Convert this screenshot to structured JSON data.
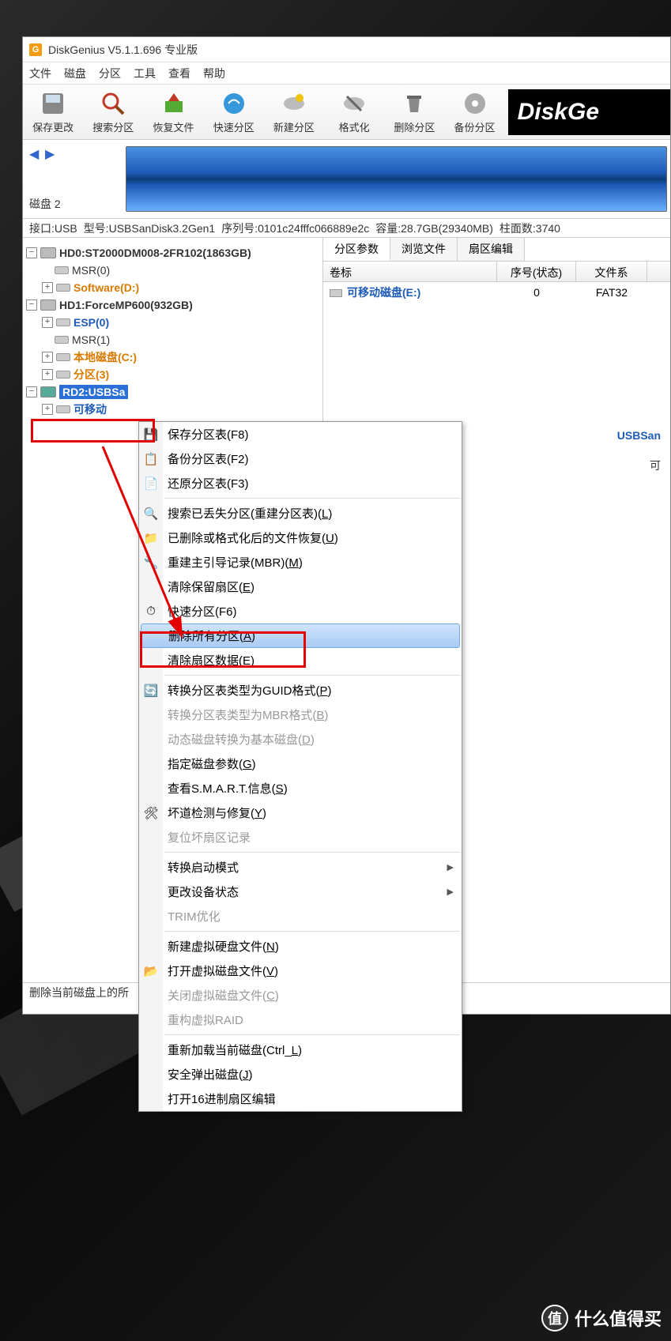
{
  "title": "DiskGenius V5.1.1.696 专业版",
  "menu": [
    "文件",
    "磁盘",
    "分区",
    "工具",
    "查看",
    "帮助"
  ],
  "toolbar": [
    "保存更改",
    "搜索分区",
    "恢复文件",
    "快速分区",
    "新建分区",
    "格式化",
    "删除分区",
    "备份分区"
  ],
  "logo_text": "DiskGe",
  "disk_nav_label": "磁盘 2",
  "info_bar": {
    "iface_k": "接口:",
    "iface_v": "USB",
    "model_k": "型号:",
    "model_v": "USBSanDisk3.2Gen1",
    "serial_k": "序列号:",
    "serial_v": "0101c24fffc066889e2c",
    "cap_k": "容量:",
    "cap_v": "28.7GB(29340MB)",
    "cyl_k": "柱面数:",
    "cyl_v": "3740"
  },
  "tree": {
    "hd0": "HD0:ST2000DM008-2FR102(1863GB)",
    "msr0": "MSR(0)",
    "soft": "Software(D:)",
    "hd1": "HD1:ForceMP600(932GB)",
    "esp": "ESP(0)",
    "msr1": "MSR(1)",
    "local": "本地磁盘(C:)",
    "p3": "分区(3)",
    "rd2": "RD2:USBSa",
    "removable": "可移动"
  },
  "tabs": [
    "分区参数",
    "浏览文件",
    "扇区编辑"
  ],
  "grid_head": {
    "vol": "卷标",
    "idx": "序号(状态)",
    "fs": "文件系"
  },
  "grid_row": {
    "vol": "可移动磁盘(E:)",
    "idx": "0",
    "fs": "FAT32"
  },
  "right_info": "USBSan",
  "right_info2": "可",
  "status": "删除当前磁盘上的所",
  "ctx": {
    "save": "保存分区表(F8)",
    "backup": "备份分区表(F2)",
    "restore": "还原分区表(F3)",
    "search": "搜索已丢失分区(重建分区表)(",
    "search_u": "L",
    "search_e": ")",
    "recover": "已删除或格式化后的文件恢复(",
    "recover_u": "U",
    "recover_e": ")",
    "mbr": "重建主引导记录(MBR)(",
    "mbr_u": "M",
    "mbr_e": ")",
    "clear_reserved": "清除保留扇区(",
    "clear_reserved_u": "E",
    "clear_reserved_e": ")",
    "quick": "快速分区(F6)",
    "delete_all": "删除所有分区(",
    "delete_all_u": "A",
    "delete_all_e": ")",
    "clear_sector": "清除扇区数据(",
    "clear_sector_u": "E",
    "clear_sector_e": ")",
    "to_guid": "转换分区表类型为GUID格式(",
    "to_guid_u": "P",
    "to_guid_e": ")",
    "to_mbr": "转换分区表类型为MBR格式(",
    "to_mbr_u": "B",
    "to_mbr_e": ")",
    "to_basic": "动态磁盘转换为基本磁盘(",
    "to_basic_u": "D",
    "to_basic_e": ")",
    "params": "指定磁盘参数(",
    "params_u": "G",
    "params_e": ")",
    "smart": "查看S.M.A.R.T.信息(",
    "smart_u": "S",
    "smart_e": ")",
    "bad": "坏道检测与修复(",
    "bad_u": "Y",
    "bad_e": ")",
    "reset_bad": "复位坏扇区记录",
    "boot": "转换启动模式",
    "device_state": "更改设备状态",
    "trim": "TRIM优化",
    "new_vhd": "新建虚拟硬盘文件(",
    "new_vhd_u": "N",
    "new_vhd_e": ")",
    "open_vhd": "打开虚拟磁盘文件(",
    "open_vhd_u": "V",
    "open_vhd_e": ")",
    "close_vhd": "关闭虚拟磁盘文件(",
    "close_vhd_u": "C",
    "close_vhd_e": ")",
    "raid": "重构虚拟RAID",
    "reload": "重新加载当前磁盘(Ctrl_",
    "reload_u": "L",
    "reload_e": ")",
    "eject": "安全弹出磁盘(",
    "eject_u": "J",
    "eject_e": ")",
    "hex": "打开16进制扇区编辑"
  },
  "watermark": "什么值得买"
}
